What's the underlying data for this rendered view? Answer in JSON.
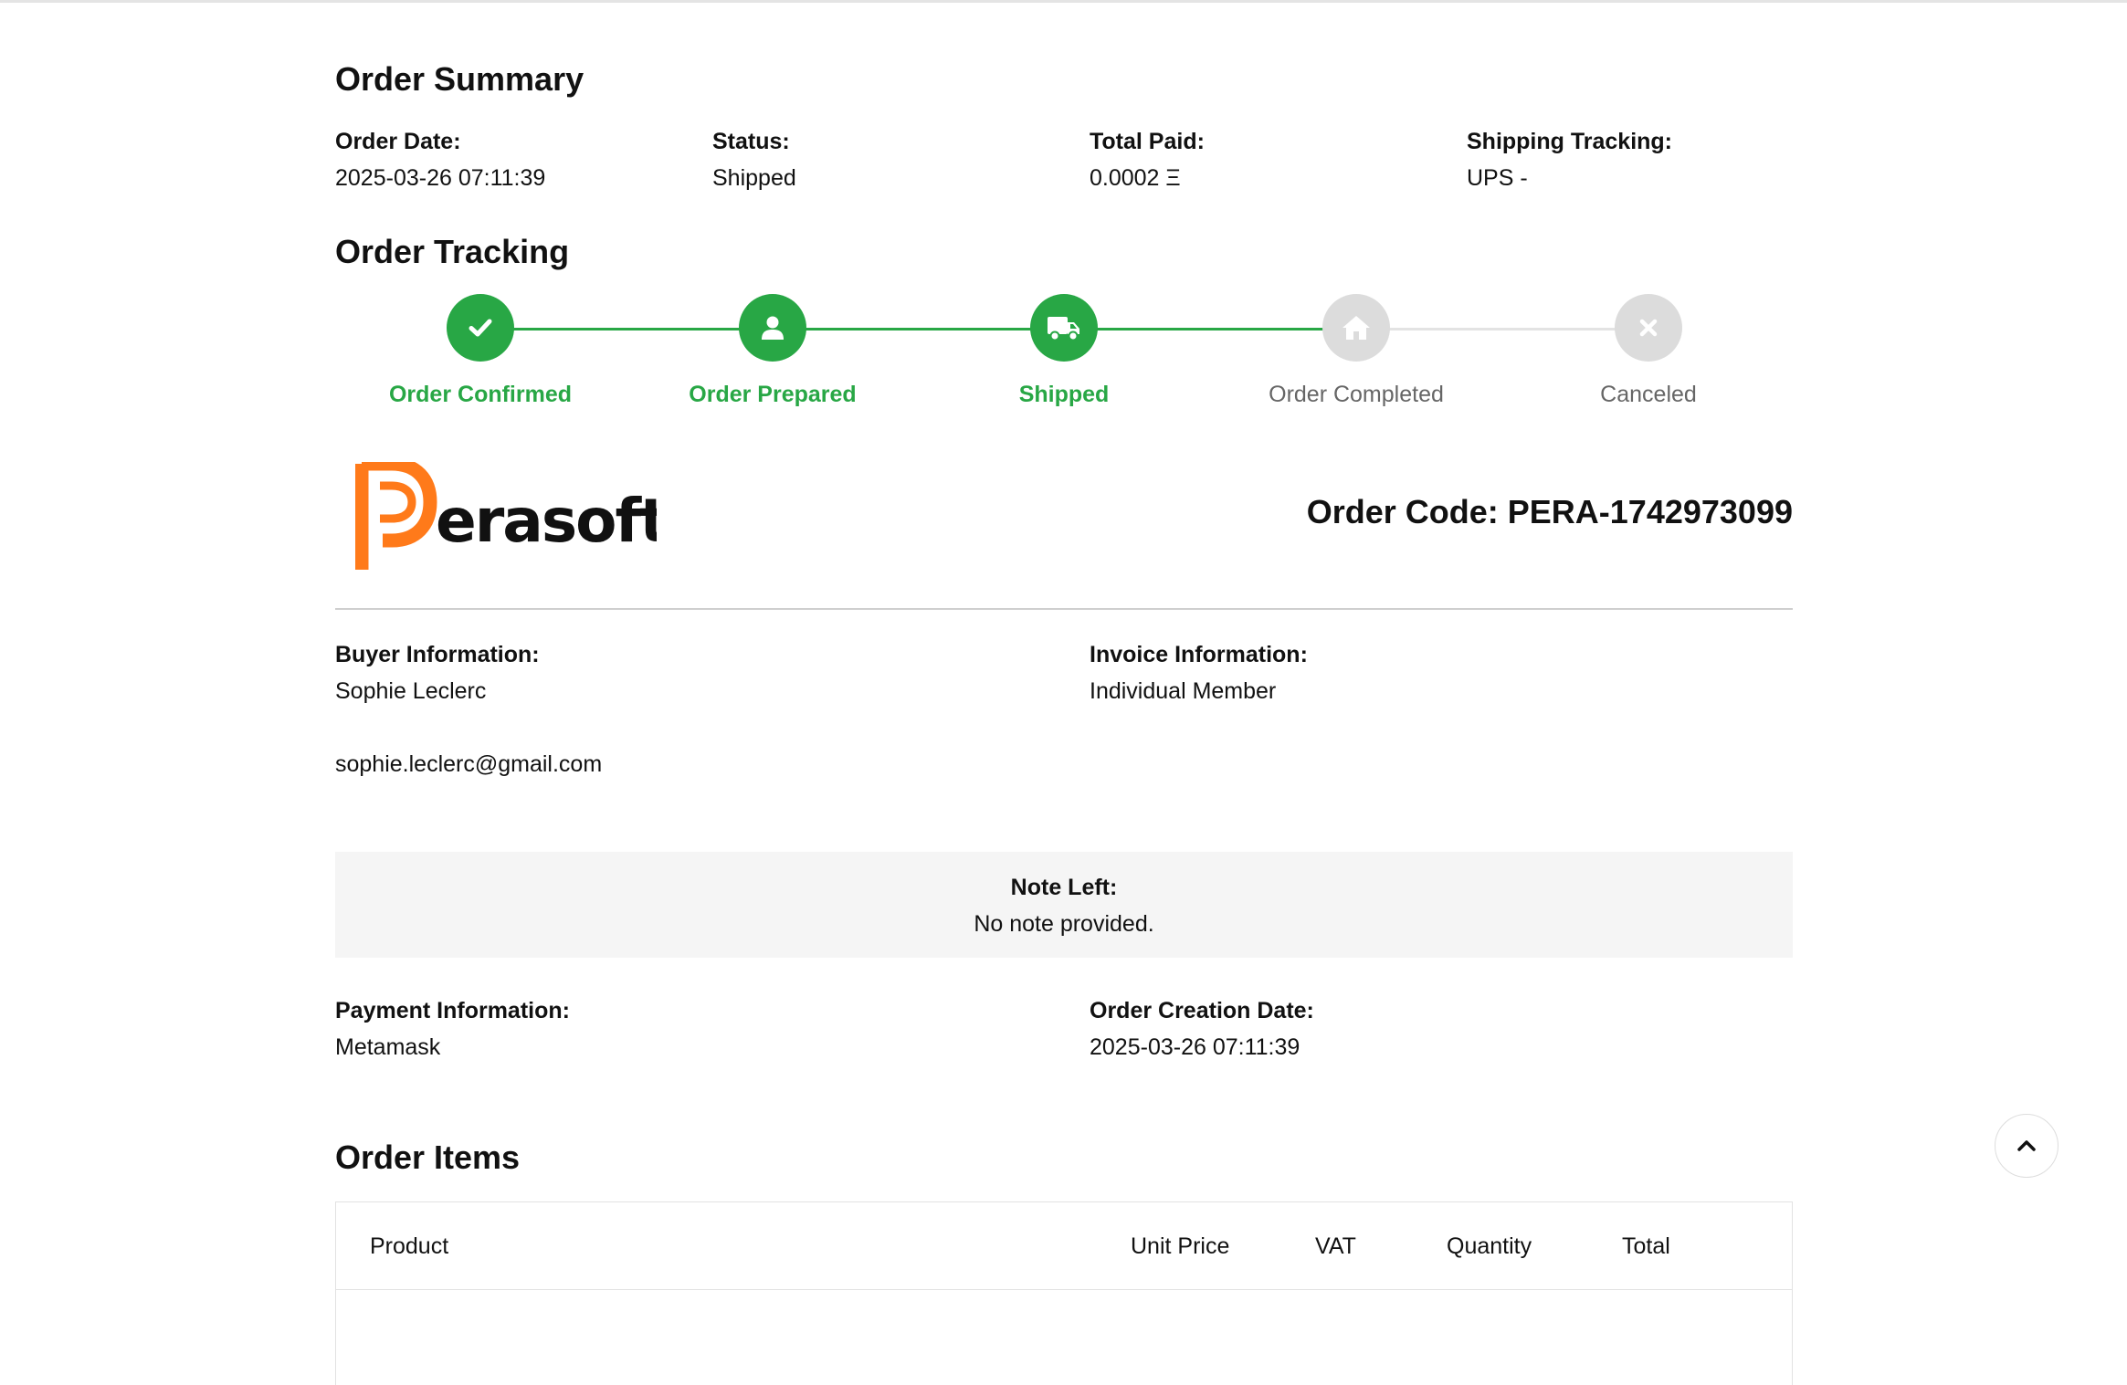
{
  "summary": {
    "title": "Order Summary",
    "order_date_label": "Order Date:",
    "order_date": "2025-03-26 07:11:39",
    "status_label": "Status:",
    "status": "Shipped",
    "total_paid_label": "Total Paid:",
    "total_paid": "0.0002 Ξ",
    "shipping_tracking_label": "Shipping Tracking:",
    "shipping_tracking": "UPS -"
  },
  "tracking": {
    "title": "Order Tracking",
    "steps": [
      {
        "label": "Order Confirmed",
        "icon": "check-icon",
        "state": "done"
      },
      {
        "label": "Order Prepared",
        "icon": "user-icon",
        "state": "done"
      },
      {
        "label": "Shipped",
        "icon": "truck-icon",
        "state": "done"
      },
      {
        "label": "Order Completed",
        "icon": "home-icon",
        "state": "pending"
      },
      {
        "label": "Canceled",
        "icon": "x-icon",
        "state": "pending"
      }
    ],
    "colors": {
      "done": "#28a745",
      "pending": "#dcdcdc"
    }
  },
  "brand": {
    "logo_text": "erasoft",
    "logo_colors": {
      "mark": "#ff7a1a",
      "text": "#111111"
    }
  },
  "order_code": "Order Code: PERA-1742973099",
  "buyer": {
    "label": "Buyer Information:",
    "name": "Sophie Leclerc",
    "email": "sophie.leclerc@gmail.com"
  },
  "invoice": {
    "label": "Invoice Information:",
    "value": "Individual Member"
  },
  "note": {
    "label": "Note Left:",
    "value": "No note provided."
  },
  "payment": {
    "label": "Payment Information:",
    "value": "Metamask"
  },
  "creation": {
    "label": "Order Creation Date:",
    "value": "2025-03-26 07:11:39"
  },
  "items": {
    "title": "Order Items",
    "columns": [
      "Product",
      "Unit Price",
      "VAT",
      "Quantity",
      "Total"
    ]
  }
}
